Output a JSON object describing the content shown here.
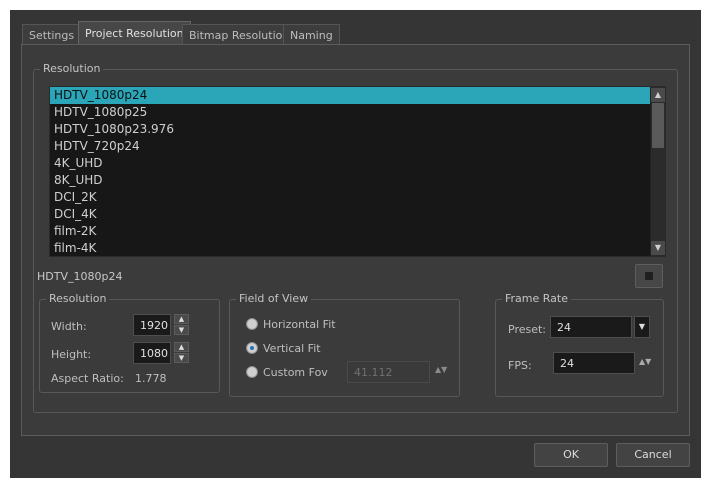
{
  "tabs": [
    {
      "label": "Settings"
    },
    {
      "label": "Project Resolution"
    },
    {
      "label": "Bitmap Resolution"
    },
    {
      "label": "Naming"
    }
  ],
  "resolution_group": {
    "title": "Resolution",
    "items": [
      {
        "label": "HDTV_1080p24"
      },
      {
        "label": "HDTV_1080p25"
      },
      {
        "label": "HDTV_1080p23.976"
      },
      {
        "label": "HDTV_720p24"
      },
      {
        "label": "4K_UHD"
      },
      {
        "label": "8K_UHD"
      },
      {
        "label": "DCI_2K"
      },
      {
        "label": "DCI_4K"
      },
      {
        "label": "film-2K"
      },
      {
        "label": "film-4K"
      }
    ],
    "selected_name": "HDTV_1080p24"
  },
  "dimensions": {
    "title": "Resolution",
    "width_label": "Width:",
    "width_value": "1920",
    "height_label": "Height:",
    "height_value": "1080",
    "aspect_label": "Aspect Ratio:",
    "aspect_value": "1.778"
  },
  "fov": {
    "title": "Field of View",
    "horizontal_label": "Horizontal Fit",
    "vertical_label": "Vertical Fit",
    "custom_label": "Custom Fov",
    "custom_value": "41.112"
  },
  "frame_rate": {
    "title": "Frame Rate",
    "preset_label": "Preset:",
    "preset_value": "24",
    "fps_label": "FPS:",
    "fps_value": "24"
  },
  "buttons": {
    "ok": "OK",
    "cancel": "Cancel"
  }
}
